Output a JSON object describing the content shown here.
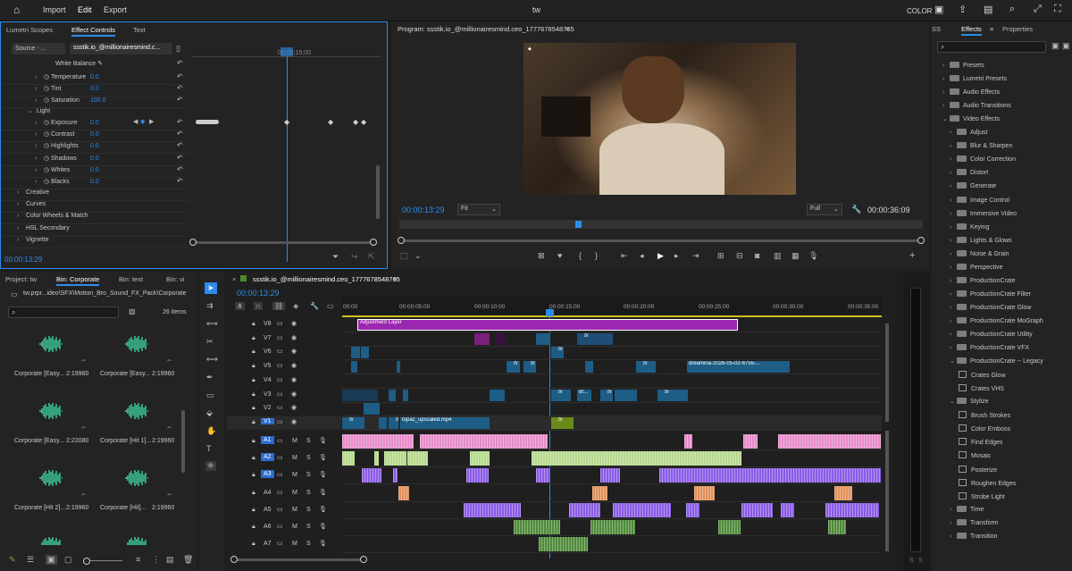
{
  "menu": {
    "home": "⌂",
    "import": "Import",
    "edit": "Edit",
    "export": "Export",
    "title": "tw",
    "color": "COLOR"
  },
  "effect_controls": {
    "tabs": [
      "Lumetri Scopes",
      "Effect Controls",
      "Text"
    ],
    "source": "Source ‧ ...",
    "clip": "ssstik.io_@millionairesmind.c...",
    "timecode": "00;00;15;00",
    "white_balance": "White Balance",
    "params": [
      {
        "label": "Temperature",
        "value": "0.0"
      },
      {
        "label": "Tint",
        "value": "0.0"
      },
      {
        "label": "Saturation",
        "value": "100.0"
      }
    ],
    "light": "Light",
    "light_params": [
      {
        "label": "Exposure",
        "value": "0.0"
      },
      {
        "label": "Contrast",
        "value": "0.0"
      },
      {
        "label": "Highlights",
        "value": "0.0"
      },
      {
        "label": "Shadows",
        "value": "0.0"
      },
      {
        "label": "Whites",
        "value": "0.0"
      },
      {
        "label": "Blacks",
        "value": "0.0"
      }
    ],
    "sections": [
      "Creative",
      "Curves",
      "Color Wheels & Match",
      "HSL Secondary",
      "Vignette"
    ],
    "footer_time": "00:00:13:29"
  },
  "program": {
    "title": "Program: ssstik.io_@millionairesmind.ceo_1777678548765",
    "timecode": "00:00:13:29",
    "fit": "Fit",
    "quality": "Full",
    "duration": "00:00:36:09"
  },
  "effects": {
    "tabs": [
      "Effects",
      "Properties"
    ],
    "search_placeholder": "",
    "items": [
      {
        "label": "Presets",
        "level": 0,
        "type": "folder",
        "open": false
      },
      {
        "label": "Lumetri Presets",
        "level": 0,
        "type": "folder",
        "open": false
      },
      {
        "label": "Audio Effects",
        "level": 0,
        "type": "folder",
        "open": false
      },
      {
        "label": "Audio Transitions",
        "level": 0,
        "type": "folder",
        "open": false
      },
      {
        "label": "Video Effects",
        "level": 0,
        "type": "folder",
        "open": true
      },
      {
        "label": "Adjust",
        "level": 1,
        "type": "folder",
        "open": false
      },
      {
        "label": "Blur & Sharpen",
        "level": 1,
        "type": "folder",
        "open": false
      },
      {
        "label": "Color Correction",
        "level": 1,
        "type": "folder",
        "open": false
      },
      {
        "label": "Distort",
        "level": 1,
        "type": "folder",
        "open": false
      },
      {
        "label": "Generate",
        "level": 1,
        "type": "folder",
        "open": false
      },
      {
        "label": "Image Control",
        "level": 1,
        "type": "folder",
        "open": false
      },
      {
        "label": "Immersive Video",
        "level": 1,
        "type": "folder",
        "open": false
      },
      {
        "label": "Keying",
        "level": 1,
        "type": "folder",
        "open": false
      },
      {
        "label": "Lights & Glows",
        "level": 1,
        "type": "folder",
        "open": false
      },
      {
        "label": "Noise & Grain",
        "level": 1,
        "type": "folder",
        "open": false
      },
      {
        "label": "Perspective",
        "level": 1,
        "type": "folder",
        "open": false
      },
      {
        "label": "ProductionCrate",
        "level": 1,
        "type": "folder",
        "open": false
      },
      {
        "label": "ProductionCrate Filter",
        "level": 1,
        "type": "folder",
        "open": false
      },
      {
        "label": "ProductionCrate Glow",
        "level": 1,
        "type": "folder",
        "open": false
      },
      {
        "label": "ProductionCrate MoGraph",
        "level": 1,
        "type": "folder",
        "open": false
      },
      {
        "label": "ProductionCrate Utility",
        "level": 1,
        "type": "folder",
        "open": false
      },
      {
        "label": "ProductionCrate VFX",
        "level": 1,
        "type": "folder",
        "open": false
      },
      {
        "label": "ProductionCrate -- Legacy",
        "level": 1,
        "type": "folder",
        "open": true
      },
      {
        "label": "Crates Glow",
        "level": 2,
        "type": "effect"
      },
      {
        "label": "Crates VHS",
        "level": 2,
        "type": "effect"
      },
      {
        "label": "Stylize",
        "level": 1,
        "type": "folder",
        "open": true
      },
      {
        "label": "Brush Strokes",
        "level": 2,
        "type": "effect"
      },
      {
        "label": "Color Emboss",
        "level": 2,
        "type": "effect"
      },
      {
        "label": "Find Edges",
        "level": 2,
        "type": "effect"
      },
      {
        "label": "Mosaic",
        "level": 2,
        "type": "effect"
      },
      {
        "label": "Posterize",
        "level": 2,
        "type": "effect"
      },
      {
        "label": "Roughen Edges",
        "level": 2,
        "type": "effect"
      },
      {
        "label": "Strobe Light",
        "level": 2,
        "type": "effect"
      },
      {
        "label": "Time",
        "level": 1,
        "type": "folder",
        "open": false
      },
      {
        "label": "Transform",
        "level": 1,
        "type": "folder",
        "open": false
      },
      {
        "label": "Transition",
        "level": 1,
        "type": "folder",
        "open": false
      }
    ]
  },
  "project": {
    "tabs": [
      "Project: tw",
      "Bin: Corporate",
      "Bin: text",
      "Bin: vi"
    ],
    "path": "tw.prpr...ideo\\SFX\\Motion_Bro_Sound_FX_Pack\\Corporate",
    "count": "26 items",
    "items": [
      {
        "name": "Corporate [Easy...",
        "dur": "2:19960"
      },
      {
        "name": "Corporate [Easy...",
        "dur": "2:19960"
      },
      {
        "name": "Corporate [Easy...",
        "dur": "2:22080"
      },
      {
        "name": "Corporate [Hit 1]...",
        "dur": "2:19960"
      },
      {
        "name": "Corporate [Hit 2]...",
        "dur": "2:19960"
      },
      {
        "name": "Corporate [Hit]...",
        "dur": "2:19960"
      }
    ]
  },
  "timeline": {
    "title": "ssstik.io_@millionairesmind.ceo_1777678548765",
    "timecode": "00:00:13:29",
    "ruler": [
      "00:00",
      "00:00:05:00",
      "00:00:10:00",
      "00:00:15:00",
      "00:00:20:00",
      "00:00:25:00",
      "00:00:30:00",
      "00:00:35:00"
    ],
    "video_tracks": [
      "V8",
      "V7",
      "V6",
      "V5",
      "V4",
      "V3",
      "V2",
      "V1"
    ],
    "audio_tracks": [
      "A1",
      "A2",
      "A3",
      "A4",
      "A5",
      "A6",
      "A7"
    ],
    "clip_labels": {
      "adjustment": "Adjustment Layer",
      "dreamina": "dreamina-2026-05-02-6755-...",
      "topaz": "topaz_upscaled.mp4",
      "dr": "dr...",
      "fx": "fx"
    },
    "colors": {
      "video": "#1e5d85",
      "adjust": "#9c27b0",
      "audio_pink": "#e68ac9",
      "audio_green": "#b5d98a",
      "audio_purple": "#8a5ce6",
      "audio_orange": "#e0915a",
      "audio_dgreen": "#4f8a3a",
      "playhead": "#2d8ceb"
    }
  }
}
